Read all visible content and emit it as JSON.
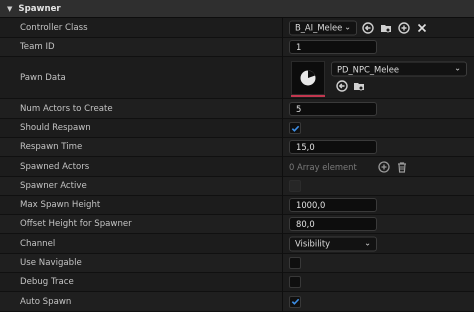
{
  "section": {
    "title": "Spawner"
  },
  "properties": {
    "controller_class": {
      "label": "Controller Class",
      "value": "B_AI_Melee"
    },
    "team_id": {
      "label": "Team ID",
      "value": "1"
    },
    "pawn_data": {
      "label": "Pawn Data",
      "value": "PD_NPC_Melee"
    },
    "num_actors": {
      "label": "Num Actors to Create",
      "value": "5"
    },
    "should_respawn": {
      "label": "Should Respawn",
      "checked": true
    },
    "respawn_time": {
      "label": "Respawn Time",
      "value": "15,0"
    },
    "spawned_actors": {
      "label": "Spawned Actors",
      "value": "0 Array element"
    },
    "spawner_active": {
      "label": "Spawner Active",
      "checked": false,
      "disabled": true
    },
    "max_spawn_height": {
      "label": "Max Spawn Height",
      "value": "1000,0"
    },
    "offset_height": {
      "label": "Offset Height for Spawner",
      "value": "80,0"
    },
    "channel": {
      "label": "Channel",
      "value": "Visibility"
    },
    "use_navigable": {
      "label": "Use Navigable",
      "checked": false
    },
    "debug_trace": {
      "label": "Debug Trace",
      "checked": false
    },
    "auto_spawn": {
      "label": "Auto Spawn",
      "checked": true
    }
  },
  "colors": {
    "accent_check": "#3d8ee6",
    "thumbnail_bar": "#c2374f",
    "background": "#151515"
  },
  "icons": {
    "section_arrow": "chevron-down-icon",
    "use_selected": "use-selected-arrow-icon",
    "browse": "browse-folder-icon",
    "add": "add-circle-icon",
    "clear": "close-icon",
    "delete": "trash-icon",
    "pawn_thumbnail": "pie-asset-icon"
  }
}
